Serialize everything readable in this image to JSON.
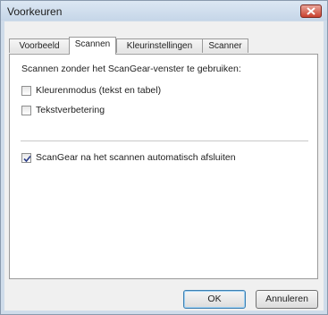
{
  "window": {
    "title": "Voorkeuren",
    "close_icon": "close-icon"
  },
  "tabs": [
    {
      "label": "Voorbeeld",
      "active": false
    },
    {
      "label": "Scannen",
      "active": true
    },
    {
      "label": "Kleurinstellingen",
      "active": false
    },
    {
      "label": "Scanner",
      "active": false
    }
  ],
  "scan_panel": {
    "intro": "Scannen zonder het ScanGear-venster te gebruiken:",
    "options": [
      {
        "label": "Kleurenmodus (tekst en tabel)",
        "checked": false
      },
      {
        "label": "Tekstverbetering",
        "checked": false
      },
      {
        "label": "ScanGear na het scannen automatisch afsluiten",
        "checked": true
      }
    ]
  },
  "buttons": {
    "ok": "OK",
    "cancel": "Annuleren"
  },
  "colors": {
    "title_bg": "#cfdcea",
    "close_red": "#c9412f",
    "default_button_border": "#3c7fb1"
  }
}
